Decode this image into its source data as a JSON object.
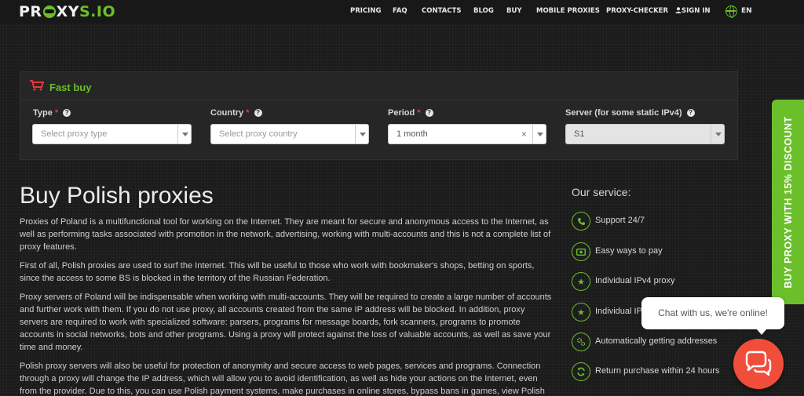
{
  "header": {
    "logo_text_a": "PR",
    "logo_text_b": "XY",
    "logo_text_c": "S.IO",
    "nav": [
      "PRICING",
      "FAQ",
      "CONTACTS",
      "BLOG",
      "BUY",
      "MOBILE PROXIES",
      "PROXY-CHECKER",
      "SIGN IN"
    ],
    "language": "EN"
  },
  "fast_buy": {
    "title": "Fast buy",
    "fields": [
      {
        "label": "Type",
        "required": "*",
        "placeholder": "Select proxy type",
        "value": ""
      },
      {
        "label": "Country",
        "required": "*",
        "placeholder": "Select proxy country",
        "value": ""
      },
      {
        "label": "Period",
        "required": "*",
        "placeholder": "",
        "value": "1 month",
        "clear": "×"
      },
      {
        "label": "Server (for some static IPv4)",
        "required": "",
        "placeholder": "",
        "value": "S1"
      }
    ]
  },
  "main": {
    "title": "Buy Polish proxies",
    "paragraphs": [
      "Proxies of Poland is a multifunctional tool for working on the Internet. They are meant for secure and anonymous access to the Internet, as well as performing tasks associated with promotion in the network, advertising, working with multi-accounts and this is not a complete list of proxy features.",
      "First of all, Polish proxies are used to surf the Internet. This will be useful to those who work with bookmaker's shops, betting on sports, since the access to some BS is blocked in the territory of the Russian Federation.",
      "Proxy servers of Poland will be indispensable when working with multi-accounts. They will be required to create a large number of accounts and further work with them. If you do not use proxy, all accounts created from the same IP address will be blocked. In addition, proxy servers are required to work with specialized software: parsers, programs for message boards, fork scanners, programs to promote accounts in social networks, bots and other programs. Using a proxy will protect against the loss of valuable accounts, as well as save your time and money.",
      "Polish proxy servers will also be useful for protection of anonymity and secure access to web pages, services and programs. Connection through a proxy will change the IP address, which will allow you to avoid identification, as well as hide your actions on the Internet, even from the provider. Due to this, you can use Polish payment systems, make purchases in online stores, bypass bans in games, view Polish"
    ]
  },
  "service": {
    "title": "Our service:",
    "items": [
      {
        "label": "Support 24/7",
        "icon": "phone-icon"
      },
      {
        "label": "Easy ways to pay",
        "icon": "money-icon"
      },
      {
        "label": "Individual IPv4 proxy",
        "icon": "star-icon"
      },
      {
        "label": "Individual IP",
        "icon": "star-icon"
      },
      {
        "label": "Automatically getting addresses",
        "icon": "gears-icon"
      },
      {
        "label": "Return purchase within 24 hours",
        "icon": "refresh-icon"
      }
    ]
  },
  "sidetab": {
    "label": "BUY PROXY WITH 15% DISCOUNT"
  },
  "chat": {
    "message": "Chat with us, we're online!"
  },
  "colors": {
    "accent": "#6bbf2a",
    "chat": "#f04e3b",
    "required": "#e53b3b"
  }
}
